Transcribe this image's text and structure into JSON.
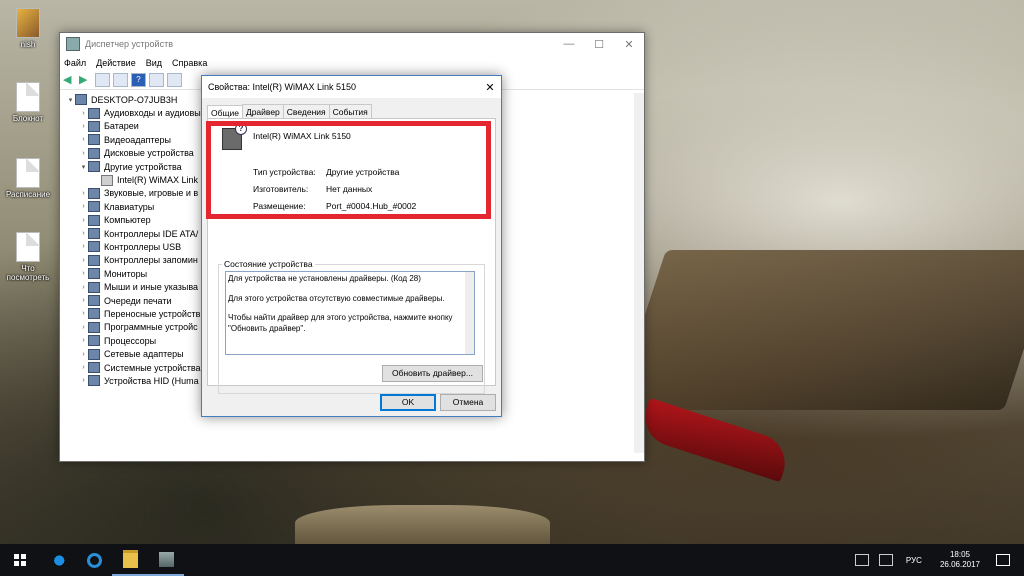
{
  "desktop": {
    "icons": [
      {
        "label": "nish",
        "type": "user"
      },
      {
        "label": "Блокнот",
        "type": "file"
      },
      {
        "label": "Расписание",
        "type": "file"
      },
      {
        "label": "Что посмотреть",
        "type": "file"
      }
    ]
  },
  "device_manager": {
    "title": "Диспетчер устройств",
    "window_controls": {
      "minimize": "—",
      "maximize": "☐",
      "close": "✕"
    },
    "menu": [
      "Файл",
      "Действие",
      "Вид",
      "Справка"
    ],
    "tree": [
      {
        "label": "DESKTOP-O7JUB3H",
        "level": 0,
        "expanded": true,
        "icon": "computer-icon"
      },
      {
        "label": "Аудиовходы и аудиовы",
        "level": 1,
        "icon": "audio-icon"
      },
      {
        "label": "Батареи",
        "level": 1,
        "icon": "battery-icon"
      },
      {
        "label": "Видеоадаптеры",
        "level": 1,
        "icon": "display-adapter-icon"
      },
      {
        "label": "Дисковые устройства",
        "level": 1,
        "icon": "disk-icon"
      },
      {
        "label": "Другие устройства",
        "level": 1,
        "expanded": true,
        "icon": "unknown-device-icon"
      },
      {
        "label": "Intel(R) WiMAX Link",
        "level": 2,
        "icon": "warning-device-icon"
      },
      {
        "label": "Звуковые, игровые и в",
        "level": 1,
        "icon": "sound-icon"
      },
      {
        "label": "Клавиатуры",
        "level": 1,
        "icon": "keyboard-icon"
      },
      {
        "label": "Компьютер",
        "level": 1,
        "icon": "computer-icon"
      },
      {
        "label": "Контроллеры IDE ATA/",
        "level": 1,
        "icon": "ide-icon"
      },
      {
        "label": "Контроллеры USB",
        "level": 1,
        "icon": "usb-icon"
      },
      {
        "label": "Контроллеры запомин",
        "level": 1,
        "icon": "storage-icon"
      },
      {
        "label": "Мониторы",
        "level": 1,
        "icon": "monitor-icon"
      },
      {
        "label": "Мыши и иные указыва",
        "level": 1,
        "icon": "mouse-icon"
      },
      {
        "label": "Очереди печати",
        "level": 1,
        "icon": "printer-icon"
      },
      {
        "label": "Переносные устройств",
        "level": 1,
        "icon": "portable-icon"
      },
      {
        "label": "Программные устройс",
        "level": 1,
        "icon": "software-icon"
      },
      {
        "label": "Процессоры",
        "level": 1,
        "icon": "cpu-icon"
      },
      {
        "label": "Сетевые адаптеры",
        "level": 1,
        "icon": "network-icon"
      },
      {
        "label": "Системные устройства",
        "level": 1,
        "icon": "system-icon"
      },
      {
        "label": "Устройства HID (Huma",
        "level": 1,
        "icon": "hid-icon"
      }
    ]
  },
  "properties": {
    "title": "Свойства: Intel(R) WiMAX Link 5150",
    "close": "✕",
    "tabs": [
      "Общие",
      "Драйвер",
      "Сведения",
      "События"
    ],
    "device_name": "Intel(R) WiMAX Link 5150",
    "rows": [
      {
        "label": "Тип устройства:",
        "value": "Другие устройства"
      },
      {
        "label": "Изготовитель:",
        "value": "Нет данных"
      },
      {
        "label": "Размещение:",
        "value": "Port_#0004.Hub_#0002"
      }
    ],
    "status_label": "Состояние устройства",
    "status_lines": [
      "Для устройства не установлены драйверы. (Код 28)",
      "Для этого устройства отсутствую совместимые драйверы.",
      "Чтобы найти драйвер для этого устройства, нажмите кнопку \"Обновить драйвер\"."
    ],
    "update_button": "Обновить драйвер...",
    "ok_button": "OK",
    "cancel_button": "Отмена"
  },
  "highlight_color": "#e3262f",
  "taskbar": {
    "language": "РУС",
    "time": "18:05",
    "date": "26.06.2017",
    "apps": [
      "edge-icon",
      "media-icon",
      "file-explorer-icon",
      "device-manager-icon"
    ]
  }
}
